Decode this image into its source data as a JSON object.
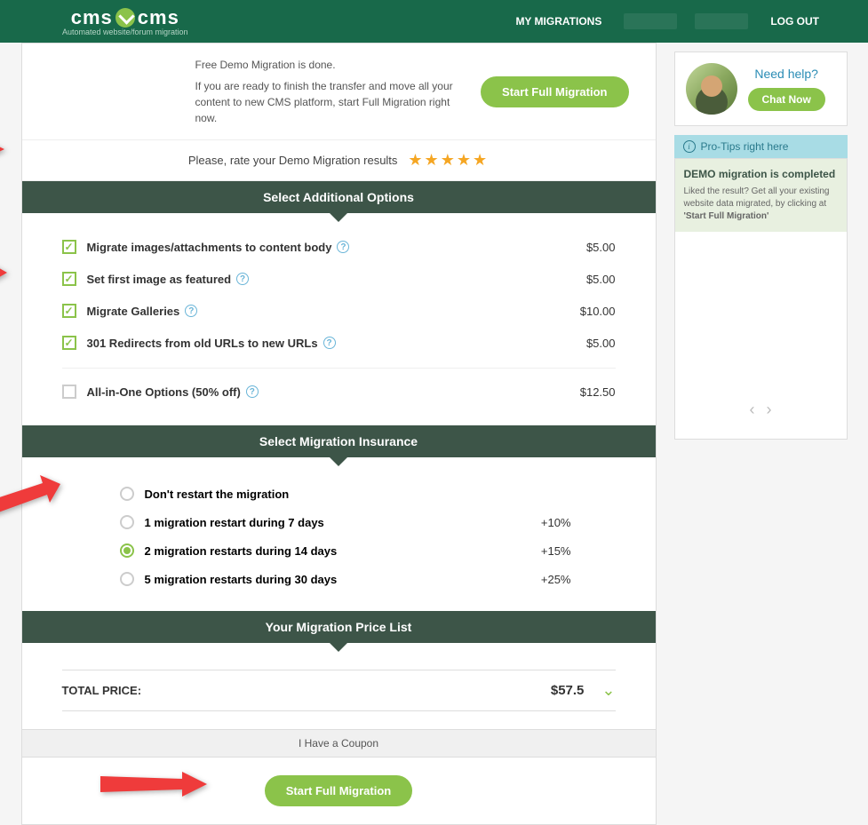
{
  "header": {
    "logo_main_left": "cms",
    "logo_main_right": "cms",
    "logo_sub": "Automated website/forum migration",
    "nav_my_migrations": "MY MIGRATIONS",
    "nav_logout": "LOG OUT"
  },
  "demo": {
    "done": "Free Demo Migration is done.",
    "ready": "If you are ready to finish the transfer and move all your content to new CMS platform, start Full Migration right now.",
    "start_btn": "Start Full Migration"
  },
  "rate": {
    "label": "Please, rate your Demo Migration results"
  },
  "sections": {
    "options": "Select Additional Options",
    "insurance": "Select Migration Insurance",
    "price": "Your Migration Price List"
  },
  "options": [
    {
      "label": "Migrate images/attachments to content body",
      "price": "$5.00",
      "checked": true
    },
    {
      "label": "Set first image as featured",
      "price": "$5.00",
      "checked": true
    },
    {
      "label": "Migrate Galleries",
      "price": "$10.00",
      "checked": true
    },
    {
      "label": "301 Redirects from old URLs to new URLs",
      "price": "$5.00",
      "checked": true
    }
  ],
  "allinone": {
    "label": "All-in-One Options (50% off)",
    "price": "$12.50",
    "checked": false
  },
  "insurance": [
    {
      "label": "Don't restart the migration",
      "pct": "",
      "selected": false
    },
    {
      "label": "1 migration restart during 7 days",
      "pct": "+10%",
      "selected": false
    },
    {
      "label": "2 migration restarts during 14 days",
      "pct": "+15%",
      "selected": true
    },
    {
      "label": "5 migration restarts during 30 days",
      "pct": "+25%",
      "selected": false
    }
  ],
  "total": {
    "label": "TOTAL PRICE:",
    "price": "$57.5"
  },
  "coupon": "I Have a Coupon",
  "cta": "Start Full Migration",
  "sidebar": {
    "need_help": "Need help?",
    "chat_now": "Chat Now",
    "protips": "Pro-Tips right here",
    "tip_title": "DEMO migration is completed",
    "tip_body_1": "Liked the result? Get all your existing website data migrated, by clicking at ",
    "tip_body_2": "'Start Full Migration'"
  }
}
